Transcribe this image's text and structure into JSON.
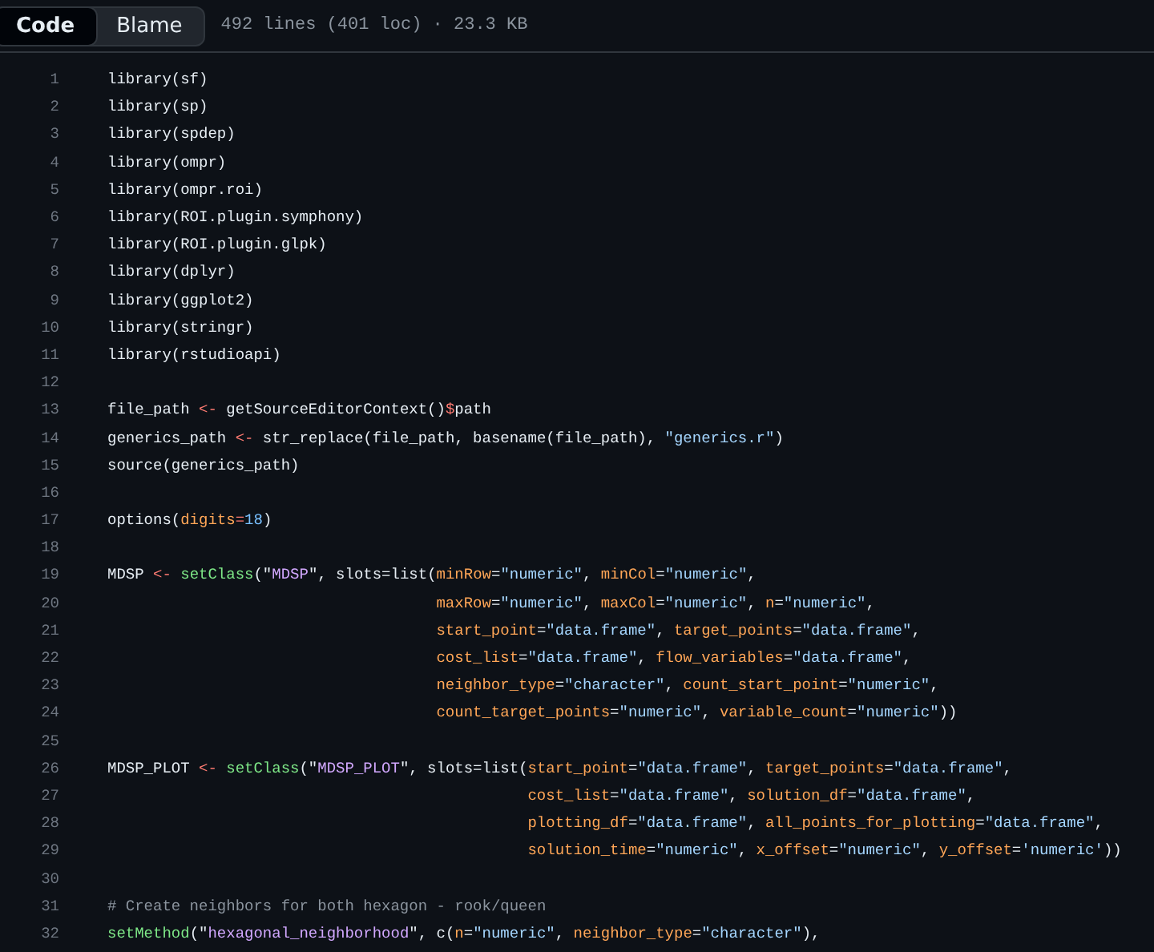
{
  "tabs": [
    {
      "label": "Code",
      "selected": true
    },
    {
      "label": "Blame",
      "selected": false
    }
  ],
  "file_info": "492 lines (401 loc) · 23.3 KB",
  "lines": [
    {
      "number": "1",
      "tokens": [
        {
          "kind": "plain",
          "text": "library(sf)"
        }
      ]
    },
    {
      "number": "2",
      "tokens": [
        {
          "kind": "plain",
          "text": "library(sp)"
        }
      ]
    },
    {
      "number": "3",
      "tokens": [
        {
          "kind": "plain",
          "text": "library(spdep)"
        }
      ]
    },
    {
      "number": "4",
      "tokens": [
        {
          "kind": "plain",
          "text": "library(ompr)"
        }
      ]
    },
    {
      "number": "5",
      "tokens": [
        {
          "kind": "plain",
          "text": "library(ompr.roi)"
        }
      ]
    },
    {
      "number": "6",
      "tokens": [
        {
          "kind": "plain",
          "text": "library(ROI.plugin.symphony)"
        }
      ]
    },
    {
      "number": "7",
      "tokens": [
        {
          "kind": "plain",
          "text": "library(ROI.plugin.glpk)"
        }
      ]
    },
    {
      "number": "8",
      "tokens": [
        {
          "kind": "plain",
          "text": "library(dplyr)"
        }
      ]
    },
    {
      "number": "9",
      "tokens": [
        {
          "kind": "plain",
          "text": "library(ggplot2)"
        }
      ]
    },
    {
      "number": "10",
      "tokens": [
        {
          "kind": "plain",
          "text": "library(stringr)"
        }
      ]
    },
    {
      "number": "11",
      "tokens": [
        {
          "kind": "plain",
          "text": "library(rstudioapi)"
        }
      ]
    },
    {
      "number": "12"
    },
    {
      "number": "13",
      "tokens": [
        {
          "kind": "plain",
          "text": "file_path "
        },
        {
          "kind": "op",
          "text": "<-"
        },
        {
          "kind": "plain",
          "text": " getSourceEditorContext()"
        },
        {
          "kind": "op",
          "text": "$"
        },
        {
          "kind": "plain",
          "text": "path"
        }
      ]
    },
    {
      "number": "14",
      "tokens": [
        {
          "kind": "plain",
          "text": "generics_path "
        },
        {
          "kind": "op",
          "text": "<-"
        },
        {
          "kind": "plain",
          "text": " str_replace(file_path, basename(file_path), "
        },
        {
          "kind": "str",
          "text": "\"generics.r\""
        },
        {
          "kind": "plain",
          "text": ")"
        }
      ]
    },
    {
      "number": "15",
      "tokens": [
        {
          "kind": "plain",
          "text": "source(generics_path)"
        }
      ]
    },
    {
      "number": "16"
    },
    {
      "number": "17",
      "tokens": [
        {
          "kind": "plain",
          "text": "options("
        },
        {
          "kind": "param",
          "text": "digits"
        },
        {
          "kind": "op",
          "text": "="
        },
        {
          "kind": "num",
          "text": "18"
        },
        {
          "kind": "plain",
          "text": ")"
        }
      ]
    },
    {
      "number": "18"
    },
    {
      "number": "19",
      "tokens": [
        {
          "kind": "plain",
          "text": "MDSP "
        },
        {
          "kind": "op",
          "text": "<- "
        },
        {
          "kind": "fn",
          "text": "setClass"
        },
        {
          "kind": "plain",
          "text": "(\""
        },
        {
          "kind": "name",
          "text": "MDSP"
        },
        {
          "kind": "plain",
          "text": "\", slots=list("
        },
        {
          "kind": "param",
          "text": "minRow"
        },
        {
          "kind": "plain",
          "text": "="
        },
        {
          "kind": "str",
          "text": "\"numeric\""
        },
        {
          "kind": "plain",
          "text": ", "
        },
        {
          "kind": "param",
          "text": "minCol"
        },
        {
          "kind": "plain",
          "text": "="
        },
        {
          "kind": "str",
          "text": "\"numeric\""
        },
        {
          "kind": "plain",
          "text": ","
        }
      ]
    },
    {
      "number": "20",
      "continues": true,
      "tokens": [
        {
          "kind": "param",
          "text": "maxRow"
        },
        {
          "kind": "plain",
          "text": "="
        },
        {
          "kind": "str",
          "text": "\"numeric\""
        },
        {
          "kind": "plain",
          "text": ", "
        },
        {
          "kind": "param",
          "text": "maxCol"
        },
        {
          "kind": "plain",
          "text": "="
        },
        {
          "kind": "str",
          "text": "\"numeric\""
        },
        {
          "kind": "plain",
          "text": ", "
        },
        {
          "kind": "param",
          "text": "n"
        },
        {
          "kind": "plain",
          "text": "="
        },
        {
          "kind": "str",
          "text": "\"numeric\""
        },
        {
          "kind": "plain",
          "text": ","
        }
      ]
    },
    {
      "number": "21",
      "continues": true,
      "tokens": [
        {
          "kind": "param",
          "text": "start_point"
        },
        {
          "kind": "plain",
          "text": "="
        },
        {
          "kind": "str",
          "text": "\"data.frame\""
        },
        {
          "kind": "plain",
          "text": ", "
        },
        {
          "kind": "param",
          "text": "target_points"
        },
        {
          "kind": "plain",
          "text": "="
        },
        {
          "kind": "str",
          "text": "\"data.frame\""
        },
        {
          "kind": "plain",
          "text": ","
        }
      ]
    },
    {
      "number": "22",
      "continues": true,
      "tokens": [
        {
          "kind": "param",
          "text": "cost_list"
        },
        {
          "kind": "plain",
          "text": "="
        },
        {
          "kind": "str",
          "text": "\"data.frame\""
        },
        {
          "kind": "plain",
          "text": ", "
        },
        {
          "kind": "param",
          "text": "flow_variables"
        },
        {
          "kind": "plain",
          "text": "="
        },
        {
          "kind": "str",
          "text": "\"data.frame\""
        },
        {
          "kind": "plain",
          "text": ","
        }
      ]
    },
    {
      "number": "23",
      "continues": true,
      "tokens": [
        {
          "kind": "param",
          "text": "neighbor_type"
        },
        {
          "kind": "plain",
          "text": "="
        },
        {
          "kind": "str",
          "text": "\"character\""
        },
        {
          "kind": "plain",
          "text": ", "
        },
        {
          "kind": "param",
          "text": "count_start_point"
        },
        {
          "kind": "plain",
          "text": "="
        },
        {
          "kind": "str",
          "text": "\"numeric\""
        },
        {
          "kind": "plain",
          "text": ","
        }
      ]
    },
    {
      "number": "24",
      "continues": true,
      "tokens": [
        {
          "kind": "param",
          "text": "count_target_points"
        },
        {
          "kind": "plain",
          "text": "="
        },
        {
          "kind": "str",
          "text": "\"numeric\""
        },
        {
          "kind": "plain",
          "text": ", "
        },
        {
          "kind": "param",
          "text": "variable_count"
        },
        {
          "kind": "plain",
          "text": "="
        },
        {
          "kind": "str",
          "text": "\"numeric\""
        },
        {
          "kind": "plain",
          "text": "))"
        }
      ]
    },
    {
      "number": "25"
    },
    {
      "number": "26",
      "tokens": [
        {
          "kind": "plain",
          "text": "MDSP_PLOT "
        },
        {
          "kind": "op",
          "text": "<- "
        },
        {
          "kind": "fn",
          "text": "setClass"
        },
        {
          "kind": "plain",
          "text": "(\""
        },
        {
          "kind": "name",
          "text": "MDSP_PLOT"
        },
        {
          "kind": "plain",
          "text": "\", slots=list("
        },
        {
          "kind": "param",
          "text": "start_point"
        },
        {
          "kind": "plain",
          "text": "="
        },
        {
          "kind": "str",
          "text": "\"data.frame\""
        },
        {
          "kind": "plain",
          "text": ", "
        },
        {
          "kind": "param",
          "text": "target_points"
        },
        {
          "kind": "plain",
          "text": "="
        },
        {
          "kind": "str",
          "text": "\"data.frame\""
        },
        {
          "kind": "plain",
          "text": ","
        }
      ]
    },
    {
      "number": "27",
      "continues": true,
      "tokens": [
        {
          "kind": "param",
          "text": "cost_list"
        },
        {
          "kind": "plain",
          "text": "="
        },
        {
          "kind": "str",
          "text": "\"data.frame\""
        },
        {
          "kind": "plain",
          "text": ", "
        },
        {
          "kind": "param",
          "text": "solution_df"
        },
        {
          "kind": "plain",
          "text": "="
        },
        {
          "kind": "str",
          "text": "\"data.frame\""
        },
        {
          "kind": "plain",
          "text": ","
        }
      ]
    },
    {
      "number": "28",
      "continues": true,
      "tokens": [
        {
          "kind": "param",
          "text": "plotting_df"
        },
        {
          "kind": "plain",
          "text": "="
        },
        {
          "kind": "str",
          "text": "\"data.frame\""
        },
        {
          "kind": "plain",
          "text": ", "
        },
        {
          "kind": "param",
          "text": "all_points_for_plotting"
        },
        {
          "kind": "plain",
          "text": "="
        },
        {
          "kind": "str",
          "text": "\"data.frame\""
        },
        {
          "kind": "plain",
          "text": ","
        }
      ]
    },
    {
      "number": "29",
      "continues": true,
      "tokens": [
        {
          "kind": "param",
          "text": "solution_time"
        },
        {
          "kind": "plain",
          "text": "="
        },
        {
          "kind": "str",
          "text": "\"numeric\""
        },
        {
          "kind": "plain",
          "text": ", "
        },
        {
          "kind": "param",
          "text": "x_offset"
        },
        {
          "kind": "plain",
          "text": "="
        },
        {
          "kind": "str",
          "text": "\"numeric\""
        },
        {
          "kind": "plain",
          "text": ", "
        },
        {
          "kind": "param",
          "text": "y_offset"
        },
        {
          "kind": "plain",
          "text": "="
        },
        {
          "kind": "str",
          "text": "'numeric'"
        },
        {
          "kind": "plain",
          "text": "))"
        }
      ]
    },
    {
      "number": "30"
    },
    {
      "number": "31",
      "tokens": [
        {
          "kind": "comment",
          "text": "# Create neighbors for both hexagon - rook/queen"
        }
      ]
    },
    {
      "number": "32",
      "tokens": [
        {
          "kind": "fn",
          "text": "setMethod"
        },
        {
          "kind": "plain",
          "text": "(\""
        },
        {
          "kind": "name",
          "text": "hexagonal_neighborhood"
        },
        {
          "kind": "plain",
          "text": "\", c("
        },
        {
          "kind": "param",
          "text": "n"
        },
        {
          "kind": "plain",
          "text": "="
        },
        {
          "kind": "str",
          "text": "\"numeric\""
        },
        {
          "kind": "plain",
          "text": ", "
        },
        {
          "kind": "param",
          "text": "neighbor_type"
        },
        {
          "kind": "plain",
          "text": "="
        },
        {
          "kind": "str",
          "text": "\"character\""
        },
        {
          "kind": "plain",
          "text": "),"
        }
      ]
    }
  ]
}
